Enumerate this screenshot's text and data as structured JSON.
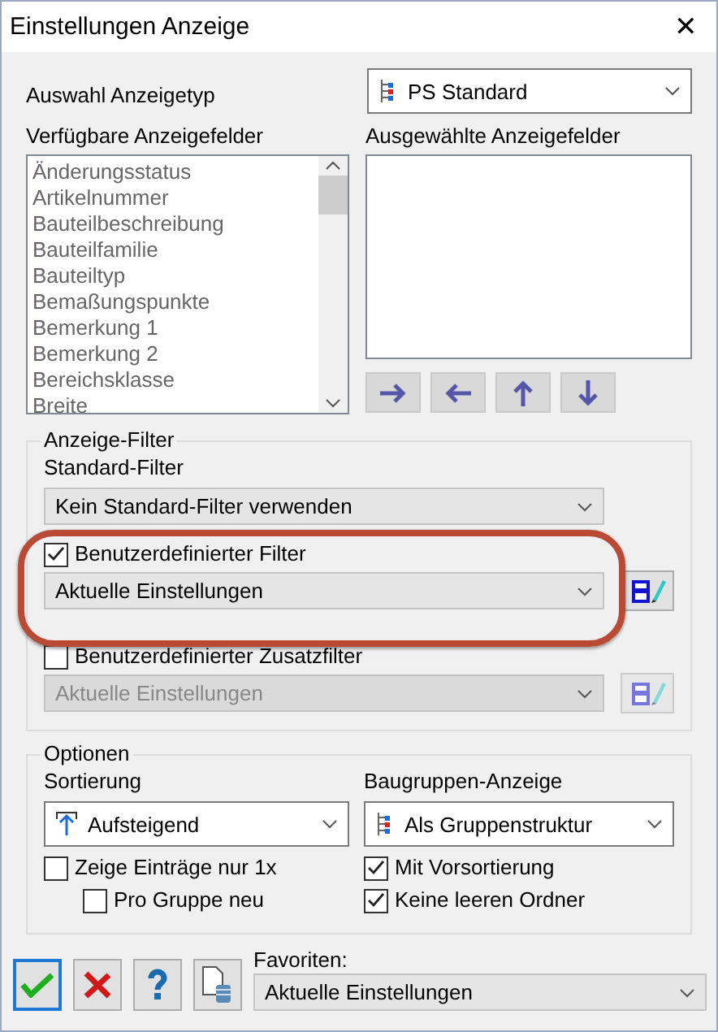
{
  "window": {
    "title": "Einstellungen Anzeige",
    "close": "✕"
  },
  "display_type": {
    "label": "Auswahl Anzeigetyp",
    "value": "PS Standard"
  },
  "available_fields": {
    "label": "Verfügbare Anzeigefelder",
    "items": [
      "Änderungsstatus",
      "Artikelnummer",
      "Bauteilbeschreibung",
      "Bauteilfamilie",
      "Bauteiltyp",
      "Bemaßungspunkte",
      "Bemerkung 1",
      "Bemerkung 2",
      "Bereichsklasse",
      "Breite"
    ]
  },
  "selected_fields": {
    "label": "Ausgewählte Anzeigefelder"
  },
  "move_buttons": [
    {
      "kind": "right"
    },
    {
      "kind": "left"
    },
    {
      "kind": "up"
    },
    {
      "kind": "down"
    }
  ],
  "display_filter": {
    "title": "Anzeige-Filter",
    "standard_label": "Standard-Filter",
    "standard_value": "Kein Standard-Filter verwenden",
    "filters": [
      {
        "label": "Benutzerdefinierter Filter",
        "checked": true,
        "value": "Aktuelle Einstellungen",
        "disabled": false,
        "highlighted": true
      },
      {
        "label": "Benutzerdefinierter Zusatzfilter",
        "checked": false,
        "value": "Aktuelle Einstellungen",
        "disabled": true,
        "highlighted": false
      }
    ]
  },
  "options": {
    "title": "Optionen",
    "sort_label": "Sortierung",
    "sort_value": "Aufsteigend",
    "group_label": "Baugruppen-Anzeige",
    "group_value": "Als Gruppenstruktur",
    "left_checks": [
      {
        "label": "Zeige Einträge nur 1x",
        "checked": false
      },
      {
        "label": "Pro Gruppe neu",
        "checked": false
      }
    ],
    "right_checks": [
      {
        "label": "Mit Vorsortierung",
        "checked": true
      },
      {
        "label": "Keine leeren Ordner",
        "checked": true
      }
    ]
  },
  "footer": {
    "buttons": [
      {
        "kind": "ok"
      },
      {
        "kind": "cancel"
      },
      {
        "kind": "help"
      },
      {
        "kind": "export"
      }
    ],
    "favorites_label": "Favoriten:",
    "favorites_value": "Aktuelle Einstellungen"
  }
}
